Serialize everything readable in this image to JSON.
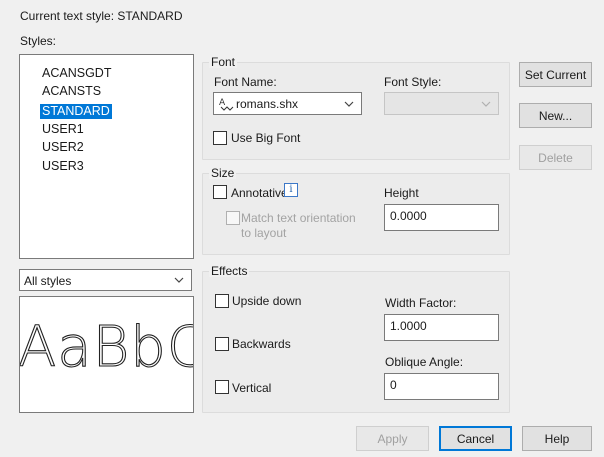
{
  "header": {
    "current_style_text": "Current text style:  STANDARD"
  },
  "styles": {
    "label": "Styles:",
    "items": [
      "ACANSGDT",
      "ACANSTS",
      "STANDARD",
      "USER1",
      "USER2",
      "USER3"
    ],
    "selected": "STANDARD"
  },
  "filter": {
    "value": "All styles"
  },
  "preview": {
    "text": "AaBbCcD"
  },
  "font": {
    "group_label": "Font",
    "name_label": "Font Name:",
    "name_value": "romans.shx",
    "style_label": "Font Style:",
    "style_value": "",
    "big_font_label": "Use Big Font",
    "big_font_checked": false
  },
  "size": {
    "group_label": "Size",
    "annotative_label": "Annotative",
    "annotative_checked": false,
    "info_glyph": "i",
    "match_label_line1": "Match text orientation",
    "match_label_line2": "to layout",
    "height_label": "Height",
    "height_value": "0.0000"
  },
  "effects": {
    "group_label": "Effects",
    "upside_down_label": "Upside down",
    "backwards_label": "Backwards",
    "vertical_label": "Vertical",
    "width_factor_label": "Width Factor:",
    "width_factor_value": "1.0000",
    "oblique_angle_label": "Oblique Angle:",
    "oblique_angle_value": "0"
  },
  "buttons": {
    "set_current": "Set Current",
    "new": "New...",
    "delete": "Delete",
    "apply": "Apply",
    "cancel": "Cancel",
    "help": "Help"
  },
  "colors": {
    "selection": "#0078d7",
    "dialog_bg": "#f0f0f0"
  },
  "icons": {
    "font_type": "shx-font-icon",
    "chevron": "chevron-down-icon",
    "info": "info-icon"
  }
}
